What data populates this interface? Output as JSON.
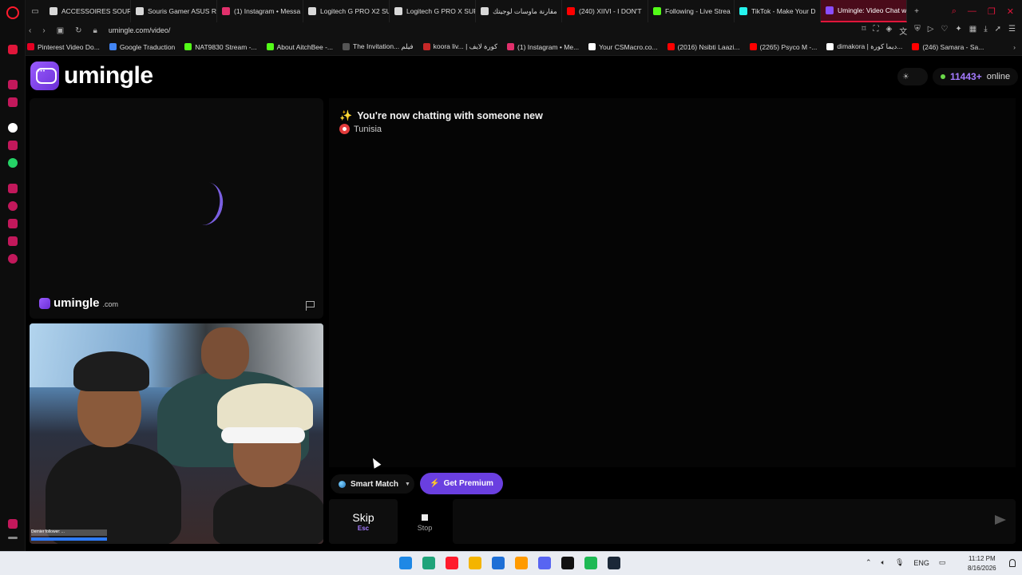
{
  "browser": {
    "tabs": [
      {
        "label": "ACCESSOIRES SOURI",
        "color": "#d8d8d8"
      },
      {
        "label": "Souris Gamer ASUS R",
        "color": "#d8d8d8"
      },
      {
        "label": "(1) Instagram • Messa",
        "color": "#e1306c"
      },
      {
        "label": "Logitech G PRO X2 SU",
        "color": "#d8d8d8"
      },
      {
        "label": "Logitech G PRO X SUP",
        "color": "#d8d8d8"
      },
      {
        "label": "مقارنة ماوسات لوجيتك",
        "color": "#d8d8d8"
      },
      {
        "label": "(240) XIIVI - I DON'T",
        "color": "#ff0000"
      },
      {
        "label": "Following - Live Strea",
        "color": "#53fc18"
      },
      {
        "label": "TikTok - Make Your D",
        "color": "#25f4ee"
      },
      {
        "label": "Umingle: Video Chat w",
        "color": "#8a4dff"
      }
    ],
    "new_tab_label": "+",
    "url": "umingle.com/video/",
    "bookmarks": [
      {
        "label": "Pinterest Video Do...",
        "color": "#e60023"
      },
      {
        "label": "Google Traduction",
        "color": "#4285f4"
      },
      {
        "label": "NAT9830 Stream -...",
        "color": "#53fc18"
      },
      {
        "label": "About AitchBee -...",
        "color": "#53fc18"
      },
      {
        "label": "The Invitation... فيلم",
        "color": "#555555"
      },
      {
        "label": "koora liv... | كورة لايف",
        "color": "#c62828"
      },
      {
        "label": "(1) Instagram • Me...",
        "color": "#e1306c"
      },
      {
        "label": "Your CSMacro.co...",
        "color": "#ffffff"
      },
      {
        "label": "(2016) Nsibti Laazi...",
        "color": "#ff0000"
      },
      {
        "label": "(2265) Psyco M -...",
        "color": "#ff0000"
      },
      {
        "label": "dimakora | ديما كورة...",
        "color": "#ffffff"
      },
      {
        "label": "(246) Samara - Sa...",
        "color": "#ff0000"
      }
    ],
    "bookmarks_more": "›"
  },
  "site": {
    "brand": "umingle",
    "online_count": "11443+",
    "online_label": "online",
    "accent": "#6a3fe0"
  },
  "stranger_panel": {
    "brand": "umingle",
    "domain": ".com"
  },
  "self_panel": {
    "overlay_text": "Dernier follower: ..."
  },
  "chat": {
    "status": "You're now chatting with someone new",
    "country": "Tunisia"
  },
  "controls": {
    "match_mode": "Smart Match",
    "premium_label": "Get Premium",
    "skip_label": "Skip",
    "skip_key": "Esc",
    "stop_label": "Stop",
    "message_placeholder": ""
  },
  "taskbar": {
    "language": "ENG",
    "time": "11:12 PM",
    "date": "8/16/2026",
    "apps": [
      {
        "name": "windows-start",
        "color": "#1e88e5"
      },
      {
        "name": "edge",
        "color": "#1fa37a"
      },
      {
        "name": "opera",
        "color": "#ff1b2d"
      },
      {
        "name": "file-explorer",
        "color": "#f4b400"
      },
      {
        "name": "security",
        "color": "#1e6fd6"
      },
      {
        "name": "illustrator",
        "color": "#ff9a00"
      },
      {
        "name": "discord",
        "color": "#5865f2"
      },
      {
        "name": "capcut",
        "color": "#111111"
      },
      {
        "name": "spotify",
        "color": "#1db954"
      },
      {
        "name": "steam",
        "color": "#1b2838"
      }
    ]
  }
}
